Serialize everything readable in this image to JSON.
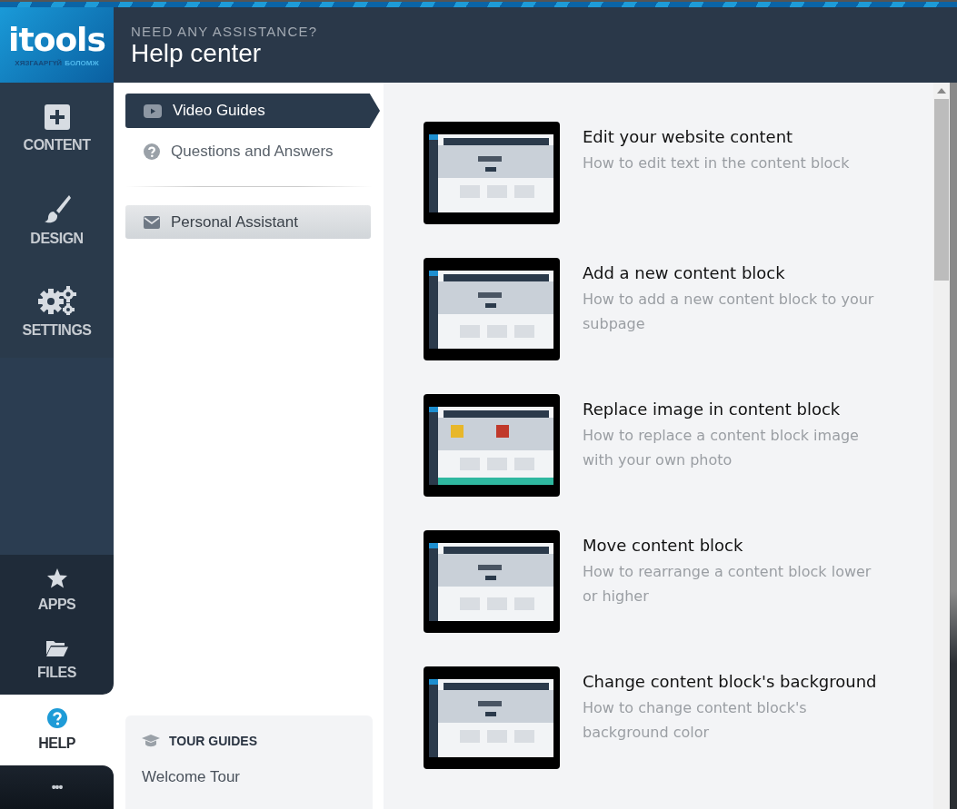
{
  "logo": {
    "text": "itools",
    "tagline": [
      "ХЯЗГААРГҮЙ",
      "БОЛОМЖ"
    ]
  },
  "header": {
    "kicker": "NEED ANY ASSISTANCE?",
    "title": "Help center"
  },
  "nav_groups": [
    {
      "items": [
        {
          "kind": "plus",
          "label": "CONTENT",
          "selected": false
        },
        {
          "kind": "brush",
          "label": "DESIGN",
          "selected": false
        },
        {
          "kind": "gears",
          "label": "SETTINGS",
          "selected": false
        }
      ]
    },
    {
      "items": [
        {
          "kind": "star",
          "label": "APPS",
          "selected": false
        },
        {
          "kind": "folder",
          "label": "FILES",
          "selected": false
        }
      ]
    },
    {
      "items": [
        {
          "kind": "help",
          "label": "HELP",
          "selected": true
        }
      ]
    },
    {
      "items": [
        {
          "kind": "more",
          "label": "•••",
          "selected": false
        }
      ]
    }
  ],
  "guides": [
    {
      "kind": "video",
      "label": "Video Guides",
      "selected": true
    },
    {
      "kind": "question",
      "label": "Questions and Answers",
      "selected": false
    }
  ],
  "assistant": {
    "label": "Personal Assistant"
  },
  "tour": {
    "title": "TOUR GUIDES",
    "items": [
      "Welcome Tour"
    ]
  },
  "videos": [
    {
      "title": "Edit your website content",
      "description": "How to edit text in the content block"
    },
    {
      "title": "Add a new content block",
      "description": "How to add a new content block to your subpage"
    },
    {
      "title": "Replace image in content block",
      "description": "How to replace a content block image with your own photo"
    },
    {
      "title": "Move content block",
      "description": "How to rearrange a content block lower or higher"
    },
    {
      "title": "Change content block's background",
      "description": "How to change content block's background color"
    }
  ]
}
